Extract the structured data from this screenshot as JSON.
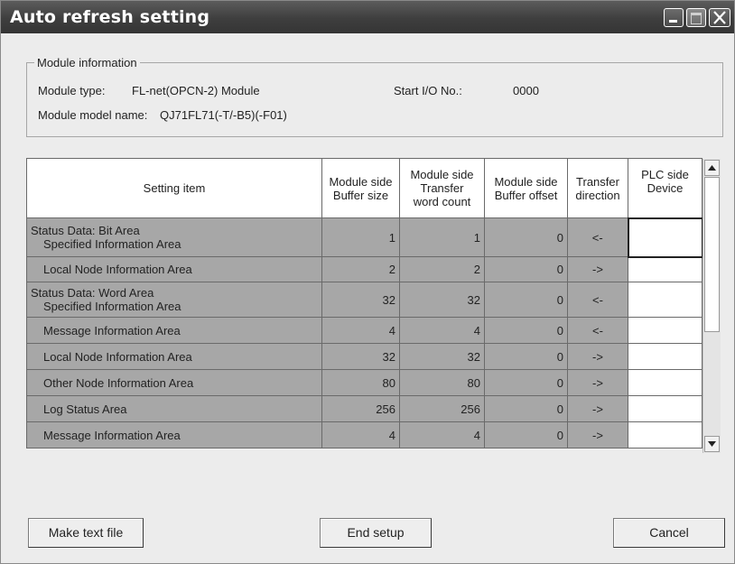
{
  "window": {
    "title": "Auto refresh setting"
  },
  "module_info": {
    "legend": "Module information",
    "type_label": "Module type:",
    "type_value": "FL-net(OPCN-2) Module",
    "start_io_label": "Start I/O No.:",
    "start_io_value": "0000",
    "model_label": "Module model name:",
    "model_value": "QJ71FL71(-T/-B5)(-F01)"
  },
  "table": {
    "headers": {
      "item": "Setting item",
      "buf_size_l1": "Module side",
      "buf_size_l2": "Buffer size",
      "word_count_l1": "Module side",
      "word_count_l2": "Transfer",
      "word_count_l3": "word count",
      "buf_offset_l1": "Module side",
      "buf_offset_l2": "Buffer offset",
      "direction_l1": "Transfer",
      "direction_l2": "direction",
      "device_l1": "PLC side",
      "device_l2": "Device"
    },
    "rows": [
      {
        "item_l1": "Status Data: Bit Area",
        "item_l2": "Specified Information Area",
        "buffer_size": "1",
        "word_count": "1",
        "buffer_offset": "0",
        "direction": "<-",
        "device": ""
      },
      {
        "item": "Local Node Information Area",
        "buffer_size": "2",
        "word_count": "2",
        "buffer_offset": "0",
        "direction": "->",
        "device": ""
      },
      {
        "item_l1": "Status Data: Word Area",
        "item_l2": "Specified Information Area",
        "buffer_size": "32",
        "word_count": "32",
        "buffer_offset": "0",
        "direction": "<-",
        "device": ""
      },
      {
        "item": "Message Information Area",
        "buffer_size": "4",
        "word_count": "4",
        "buffer_offset": "0",
        "direction": "<-",
        "device": ""
      },
      {
        "item": "Local Node Information Area",
        "buffer_size": "32",
        "word_count": "32",
        "buffer_offset": "0",
        "direction": "->",
        "device": ""
      },
      {
        "item": "Other Node Information Area",
        "buffer_size": "80",
        "word_count": "80",
        "buffer_offset": "0",
        "direction": "->",
        "device": ""
      },
      {
        "item": "Log Status Area",
        "buffer_size": "256",
        "word_count": "256",
        "buffer_offset": "0",
        "direction": "->",
        "device": ""
      },
      {
        "item": "Message Information Area",
        "buffer_size": "4",
        "word_count": "4",
        "buffer_offset": "0",
        "direction": "->",
        "device": ""
      }
    ]
  },
  "buttons": {
    "make_text_file": "Make text file",
    "end_setup": "End setup",
    "cancel": "Cancel"
  },
  "icons": {
    "minimize": "minimize-icon",
    "maximize": "maximize-icon",
    "close": "close-icon",
    "scroll_up": "arrow-up-icon",
    "scroll_down": "arrow-down-icon"
  }
}
